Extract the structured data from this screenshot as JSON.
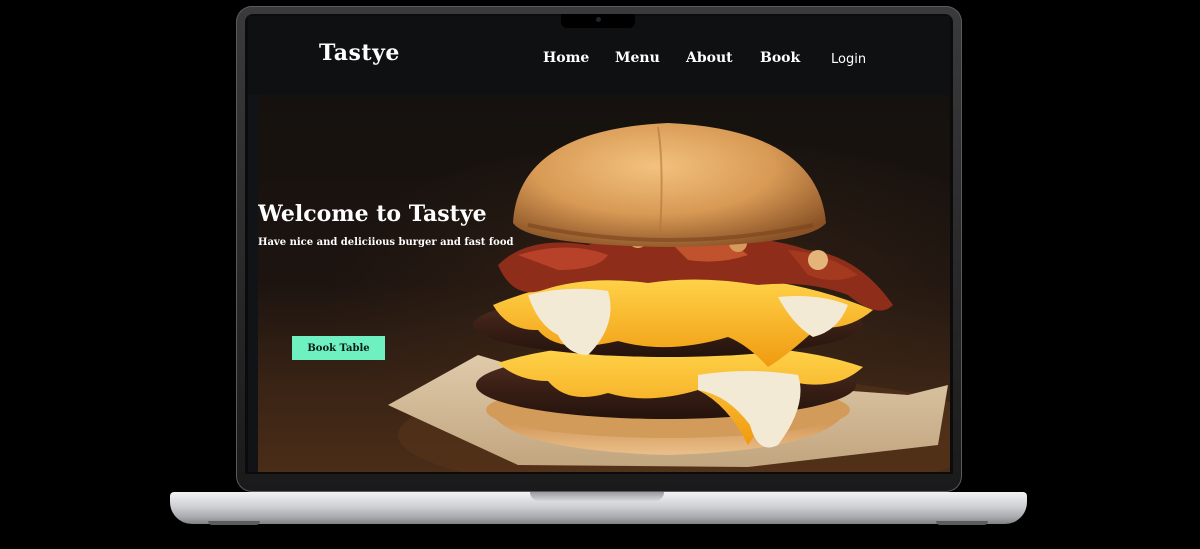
{
  "site": {
    "brand": "Tastye"
  },
  "nav": {
    "items": [
      {
        "label": "Home"
      },
      {
        "label": "Menu"
      },
      {
        "label": "About"
      },
      {
        "label": "Book"
      }
    ],
    "login_label": "Login"
  },
  "hero": {
    "title": "Welcome to Tastye",
    "subtitle": "Have nice and deliciious burger and fast food",
    "cta_label": "Book Table",
    "image": "burger-photo"
  },
  "colors": {
    "accent": "#6ef0c0",
    "navbar_bg": "#0f1012",
    "text": "#ffffff"
  }
}
